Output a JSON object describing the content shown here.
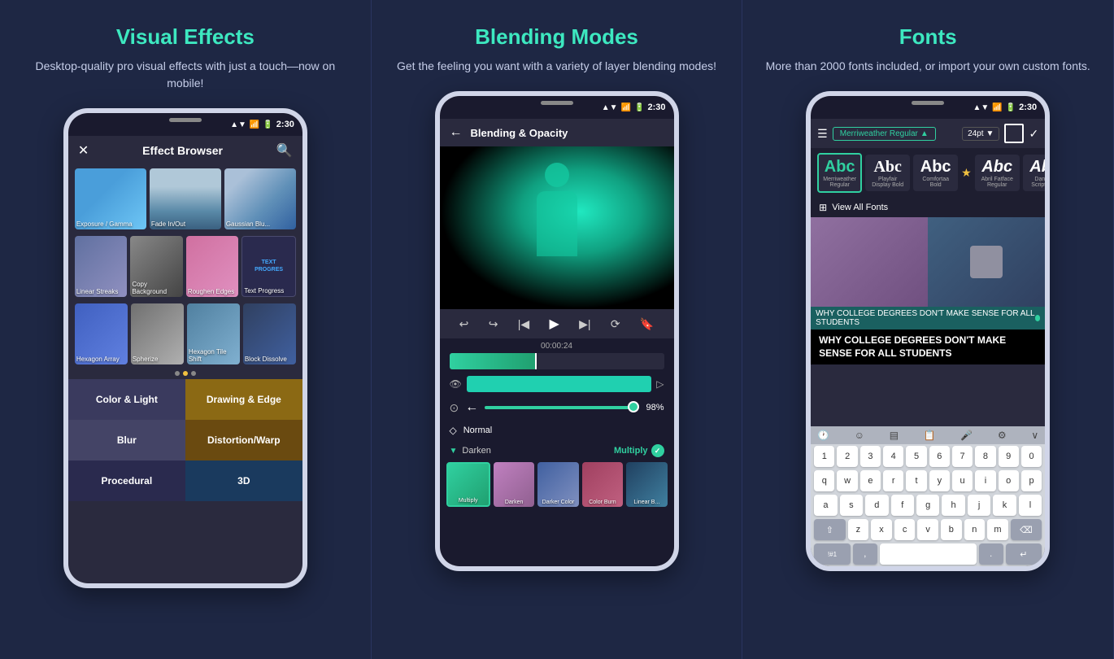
{
  "panels": [
    {
      "id": "visual-effects",
      "title": "Visual Effects",
      "subtitle": "Desktop-quality pro visual effects\nwith just a touch—now on mobile!",
      "phone": {
        "time": "2:30",
        "header_left": "✕",
        "header_title": "Effect Browser",
        "header_right": "🔍",
        "effects_row1": [
          {
            "label": "Exposure / Gamma",
            "thumb": "sky"
          },
          {
            "label": "Fade In/Out",
            "thumb": "lake"
          },
          {
            "label": "Gaussian Blu...",
            "thumb": "blue"
          }
        ],
        "effects_row2": [
          {
            "label": "Linear Streaks",
            "thumb": "streaks"
          },
          {
            "label": "Copy Background",
            "thumb": "copy"
          },
          {
            "label": "Roughen Edges",
            "thumb": "roughen"
          },
          {
            "label": "Text Progress",
            "thumb": "text"
          }
        ],
        "effects_row3": [
          {
            "label": "Hexagon Array",
            "thumb": "hex"
          },
          {
            "label": "Spherize",
            "thumb": "sphere"
          },
          {
            "label": "Hexagon Tile Shift",
            "thumb": "hextile"
          },
          {
            "label": "Block Dissolve",
            "thumb": "block"
          }
        ],
        "categories": [
          {
            "label": "Color & Light",
            "style": "light"
          },
          {
            "label": "Drawing & Edge",
            "style": "drawing"
          },
          {
            "label": "Blur",
            "style": "blur"
          },
          {
            "label": "Distortion/Warp",
            "style": "distort"
          },
          {
            "label": "Procedural",
            "style": "procedural"
          },
          {
            "label": "3D",
            "style": "3d"
          }
        ]
      }
    },
    {
      "id": "blending-modes",
      "title": "Blending Modes",
      "subtitle": "Get the feeling you want with a variety\nof layer blending modes!",
      "phone": {
        "time": "2:30",
        "header_title": "Blending & Opacity",
        "playback_time": "00:00:24",
        "opacity_pct": "98%",
        "blend_mode": "Normal",
        "blend_section": "Darken",
        "active_blend": "Multiply",
        "blend_thumbs": [
          {
            "label": "Multiply",
            "active": true
          },
          {
            "label": "Darken"
          },
          {
            "label": "Darker Color"
          },
          {
            "label": "Color Burn"
          },
          {
            "label": "Linear B..."
          }
        ]
      }
    },
    {
      "id": "fonts",
      "title": "Fonts",
      "subtitle": "More than 2000 fonts included,\nor import your own custom fonts.",
      "phone": {
        "time": "2:30",
        "font_name": "Merriweather Regular",
        "font_size": "24pt",
        "font_options": [
          {
            "name": "Merriweather\nRegular",
            "selected": true
          },
          {
            "name": "Playfair\nDisplay Bold"
          },
          {
            "name": "Comfortaa\nBold"
          },
          {
            "name": "Abril Fatface\nRegular"
          },
          {
            "name": "Dancing\nScript Bold"
          }
        ],
        "view_all": "View All Fonts",
        "overlay_text1": "WHY COLLEGE DEGREES DON'T\nMAKE SENSE FOR ALL STUDENTS",
        "overlay_text2": "WHY COLLEGE DEGREES DON'T\nMAKE SENSE FOR ALL STUDENTS",
        "keyboard_rows": [
          [
            "1",
            "2",
            "3",
            "4",
            "5",
            "6",
            "7",
            "8",
            "9",
            "0"
          ],
          [
            "q",
            "w",
            "e",
            "r",
            "t",
            "y",
            "u",
            "i",
            "o",
            "p"
          ],
          [
            "a",
            "s",
            "d",
            "f",
            "g",
            "h",
            "j",
            "k",
            "l"
          ],
          [
            "z",
            "x",
            "c",
            "v",
            "b",
            "n",
            "m"
          ],
          [
            "!#1",
            "",
            "space",
            "",
            ".",
            "↵"
          ]
        ]
      }
    }
  ]
}
